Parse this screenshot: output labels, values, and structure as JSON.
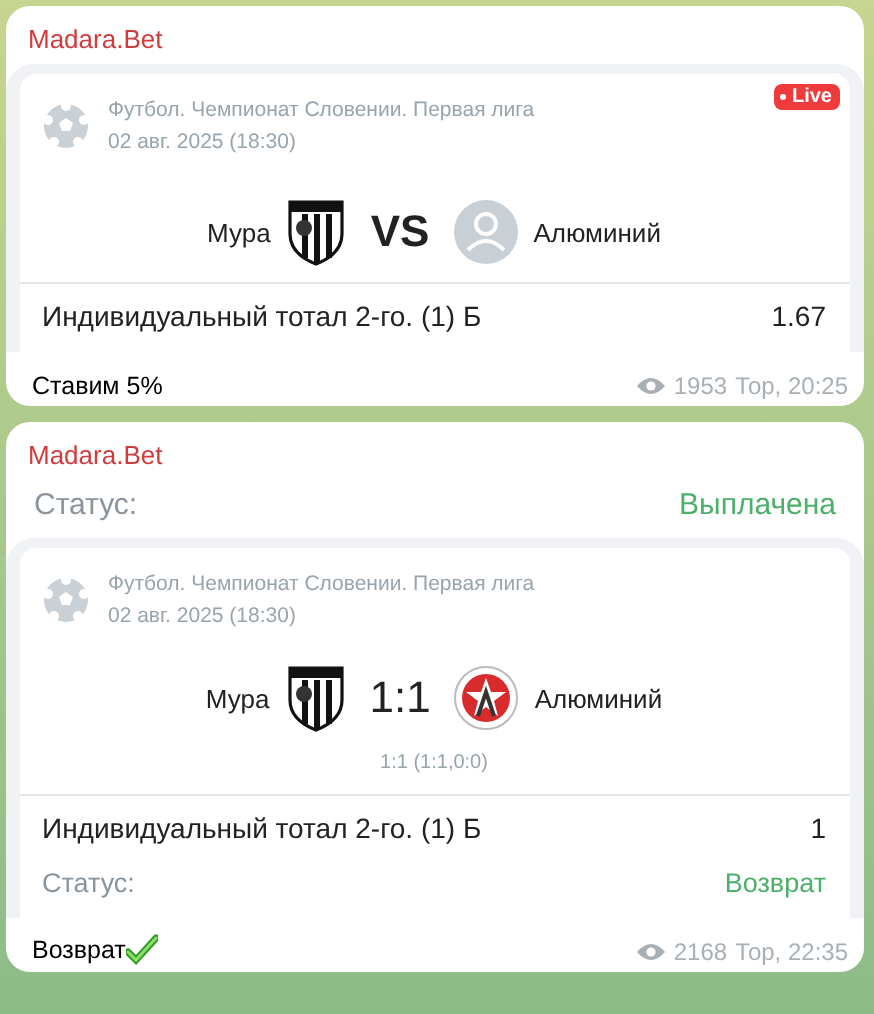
{
  "messages": [
    {
      "sender": "Madara.Bet",
      "card": {
        "badge": "Live",
        "league": "Футбол. Чемпионат Словении. Первая лига",
        "date": "02 авг. 2025 (18:30)",
        "home": "Мура",
        "home_logo": {
          "kind": "shield"
        },
        "center": {
          "kind": "vs",
          "text": "VS"
        },
        "away": "Алюминий",
        "away_logo": {
          "kind": "placeholder"
        },
        "bet": {
          "name": "Индивидуальный тотал 2-го. (1) Б",
          "odds": "1.67"
        }
      },
      "caption": "Ставим 5%",
      "caption_check": false,
      "views": "1953",
      "time": "Тор, 20:25"
    },
    {
      "sender": "Madara.Bet",
      "status": {
        "label": "Статус:",
        "value": "Выплачена"
      },
      "card": {
        "league": "Футбол. Чемпионат Словении. Первая лига",
        "date": "02 авг. 2025 (18:30)",
        "home": "Мура",
        "home_logo": {
          "kind": "shield"
        },
        "center": {
          "kind": "score",
          "text": "1:1"
        },
        "away": "Алюминий",
        "away_logo": {
          "kind": "star"
        },
        "score_detail": "1:1 (1:1,0:0)",
        "bet": {
          "name": "Индивидуальный тотал 2-го. (1) Б",
          "odds": "1"
        },
        "bet_status": {
          "label": "Статус:",
          "value": "Возврат"
        }
      },
      "caption": "Возврат",
      "caption_check": true,
      "views": "2168",
      "time": "Тор, 22:35"
    }
  ]
}
